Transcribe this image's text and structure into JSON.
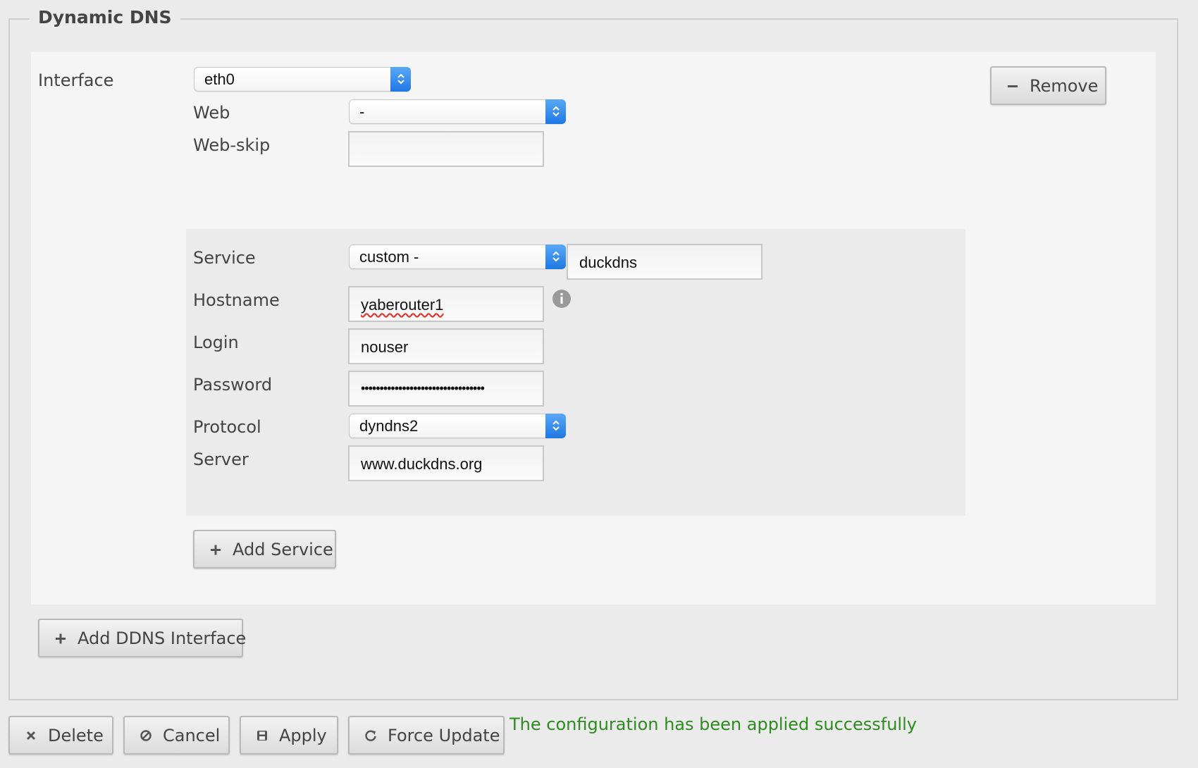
{
  "section": {
    "title": "Dynamic DNS"
  },
  "interface": {
    "label": "Interface",
    "value": "eth0",
    "remove_label": "Remove"
  },
  "web": {
    "label": "Web",
    "value": "-"
  },
  "web_skip": {
    "label": "Web-skip",
    "value": ""
  },
  "service": {
    "service_label": "Service",
    "service_value": "custom -",
    "custom_name": "duckdns",
    "hostname_label": "Hostname",
    "hostname_value": "yaberouter1",
    "login_label": "Login",
    "login_value": "nouser",
    "password_label": "Password",
    "password_masked": "•••••••••••••••••••••••••••••••••",
    "protocol_label": "Protocol",
    "protocol_value": "dyndns2",
    "server_label": "Server",
    "server_value": "www.duckdns.org"
  },
  "buttons": {
    "add_service": "Add Service",
    "add_ddns_interface": "Add DDNS Interface",
    "delete": "Delete",
    "cancel": "Cancel",
    "apply": "Apply",
    "force_update": "Force Update"
  },
  "status": {
    "message": "The configuration has been applied successfully"
  },
  "colors": {
    "select_arrow": "#1f78e4",
    "success_text": "#2e8b1f",
    "background": "#ebebeb"
  },
  "icons": {
    "remove": "minus-icon",
    "add": "plus-icon",
    "delete": "close-icon",
    "cancel": "ban-icon",
    "apply": "save-icon",
    "force_update": "refresh-icon",
    "hostname_help": "info-icon"
  }
}
